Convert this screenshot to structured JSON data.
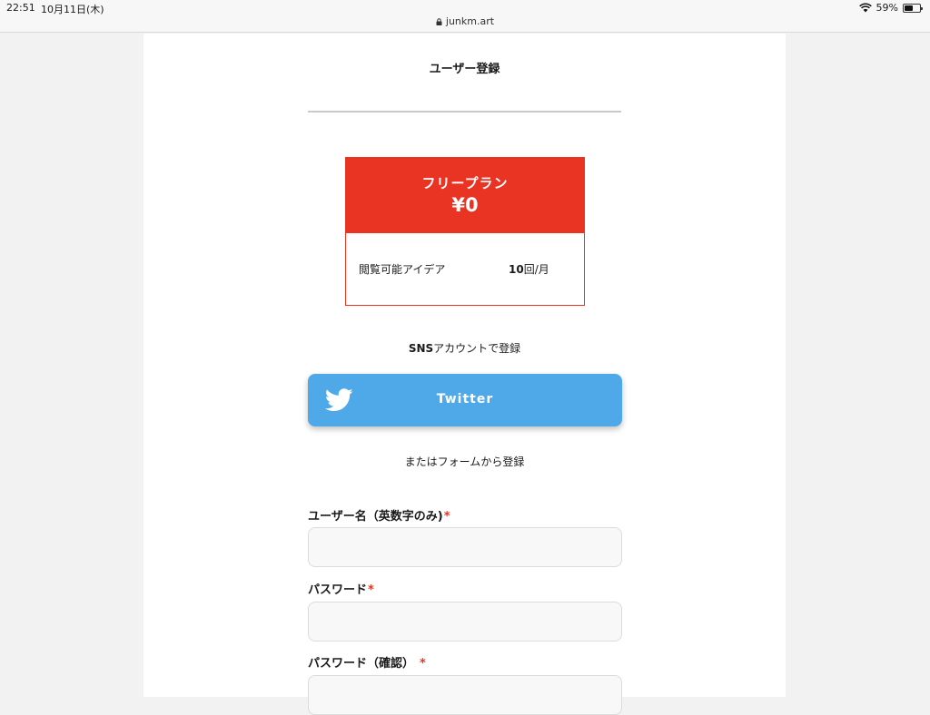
{
  "status_bar": {
    "time": "22:51",
    "date": "10月11日(木)",
    "url": "junkm.art",
    "battery_percent": "59%",
    "battery_level": 0.59
  },
  "page": {
    "title": "ユーザー登録"
  },
  "plan": {
    "name": "フリープラン",
    "price": "¥0",
    "feature_label": "閲覧可能アイデア",
    "feature_value_number": "10",
    "feature_value_unit": "回/月",
    "accent_color": "#e93323"
  },
  "sns": {
    "caption_bold": "SNS",
    "caption_rest": "アカウントで登録",
    "twitter_label": "Twitter",
    "twitter_icon": "twitter-bird-icon",
    "twitter_color": "#4fa9e9"
  },
  "form": {
    "caption": "またはフォームから登録",
    "fields": [
      {
        "label": "ユーザー名（英数字のみ)",
        "required_mark": "*",
        "value": ""
      },
      {
        "label": "パスワード",
        "required_mark": "*",
        "value": ""
      },
      {
        "label": "パスワード（確認）",
        "required_mark": "*",
        "value": ""
      }
    ]
  }
}
